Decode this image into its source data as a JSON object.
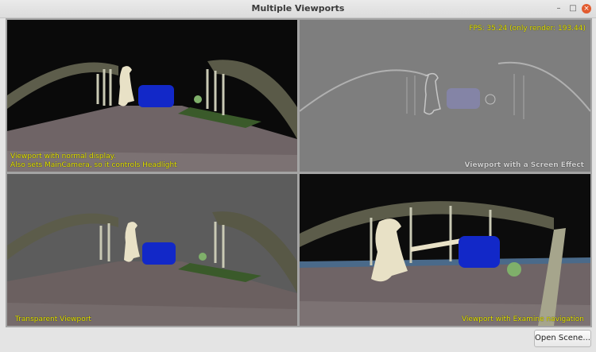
{
  "window": {
    "title": "Multiple Viewports",
    "minimize": "–",
    "maximize": "□",
    "close": "×"
  },
  "viewports": {
    "top_left": {
      "label_line1": "Viewport with normal display.",
      "label_line2": "Also sets MainCamera, so it controls Headlight"
    },
    "top_right": {
      "fps": "FPS: 35.24 (only render: 193.44)",
      "label": "Viewport with a Screen Effect"
    },
    "bottom_left": {
      "label": "Transparent Viewport"
    },
    "bottom_right": {
      "label": "Viewport with Examine navigation"
    }
  },
  "footer": {
    "open_scene_label": "Open Scene..."
  },
  "colors": {
    "label_yellow": "#e6e600",
    "close_button": "#e25b2f"
  }
}
